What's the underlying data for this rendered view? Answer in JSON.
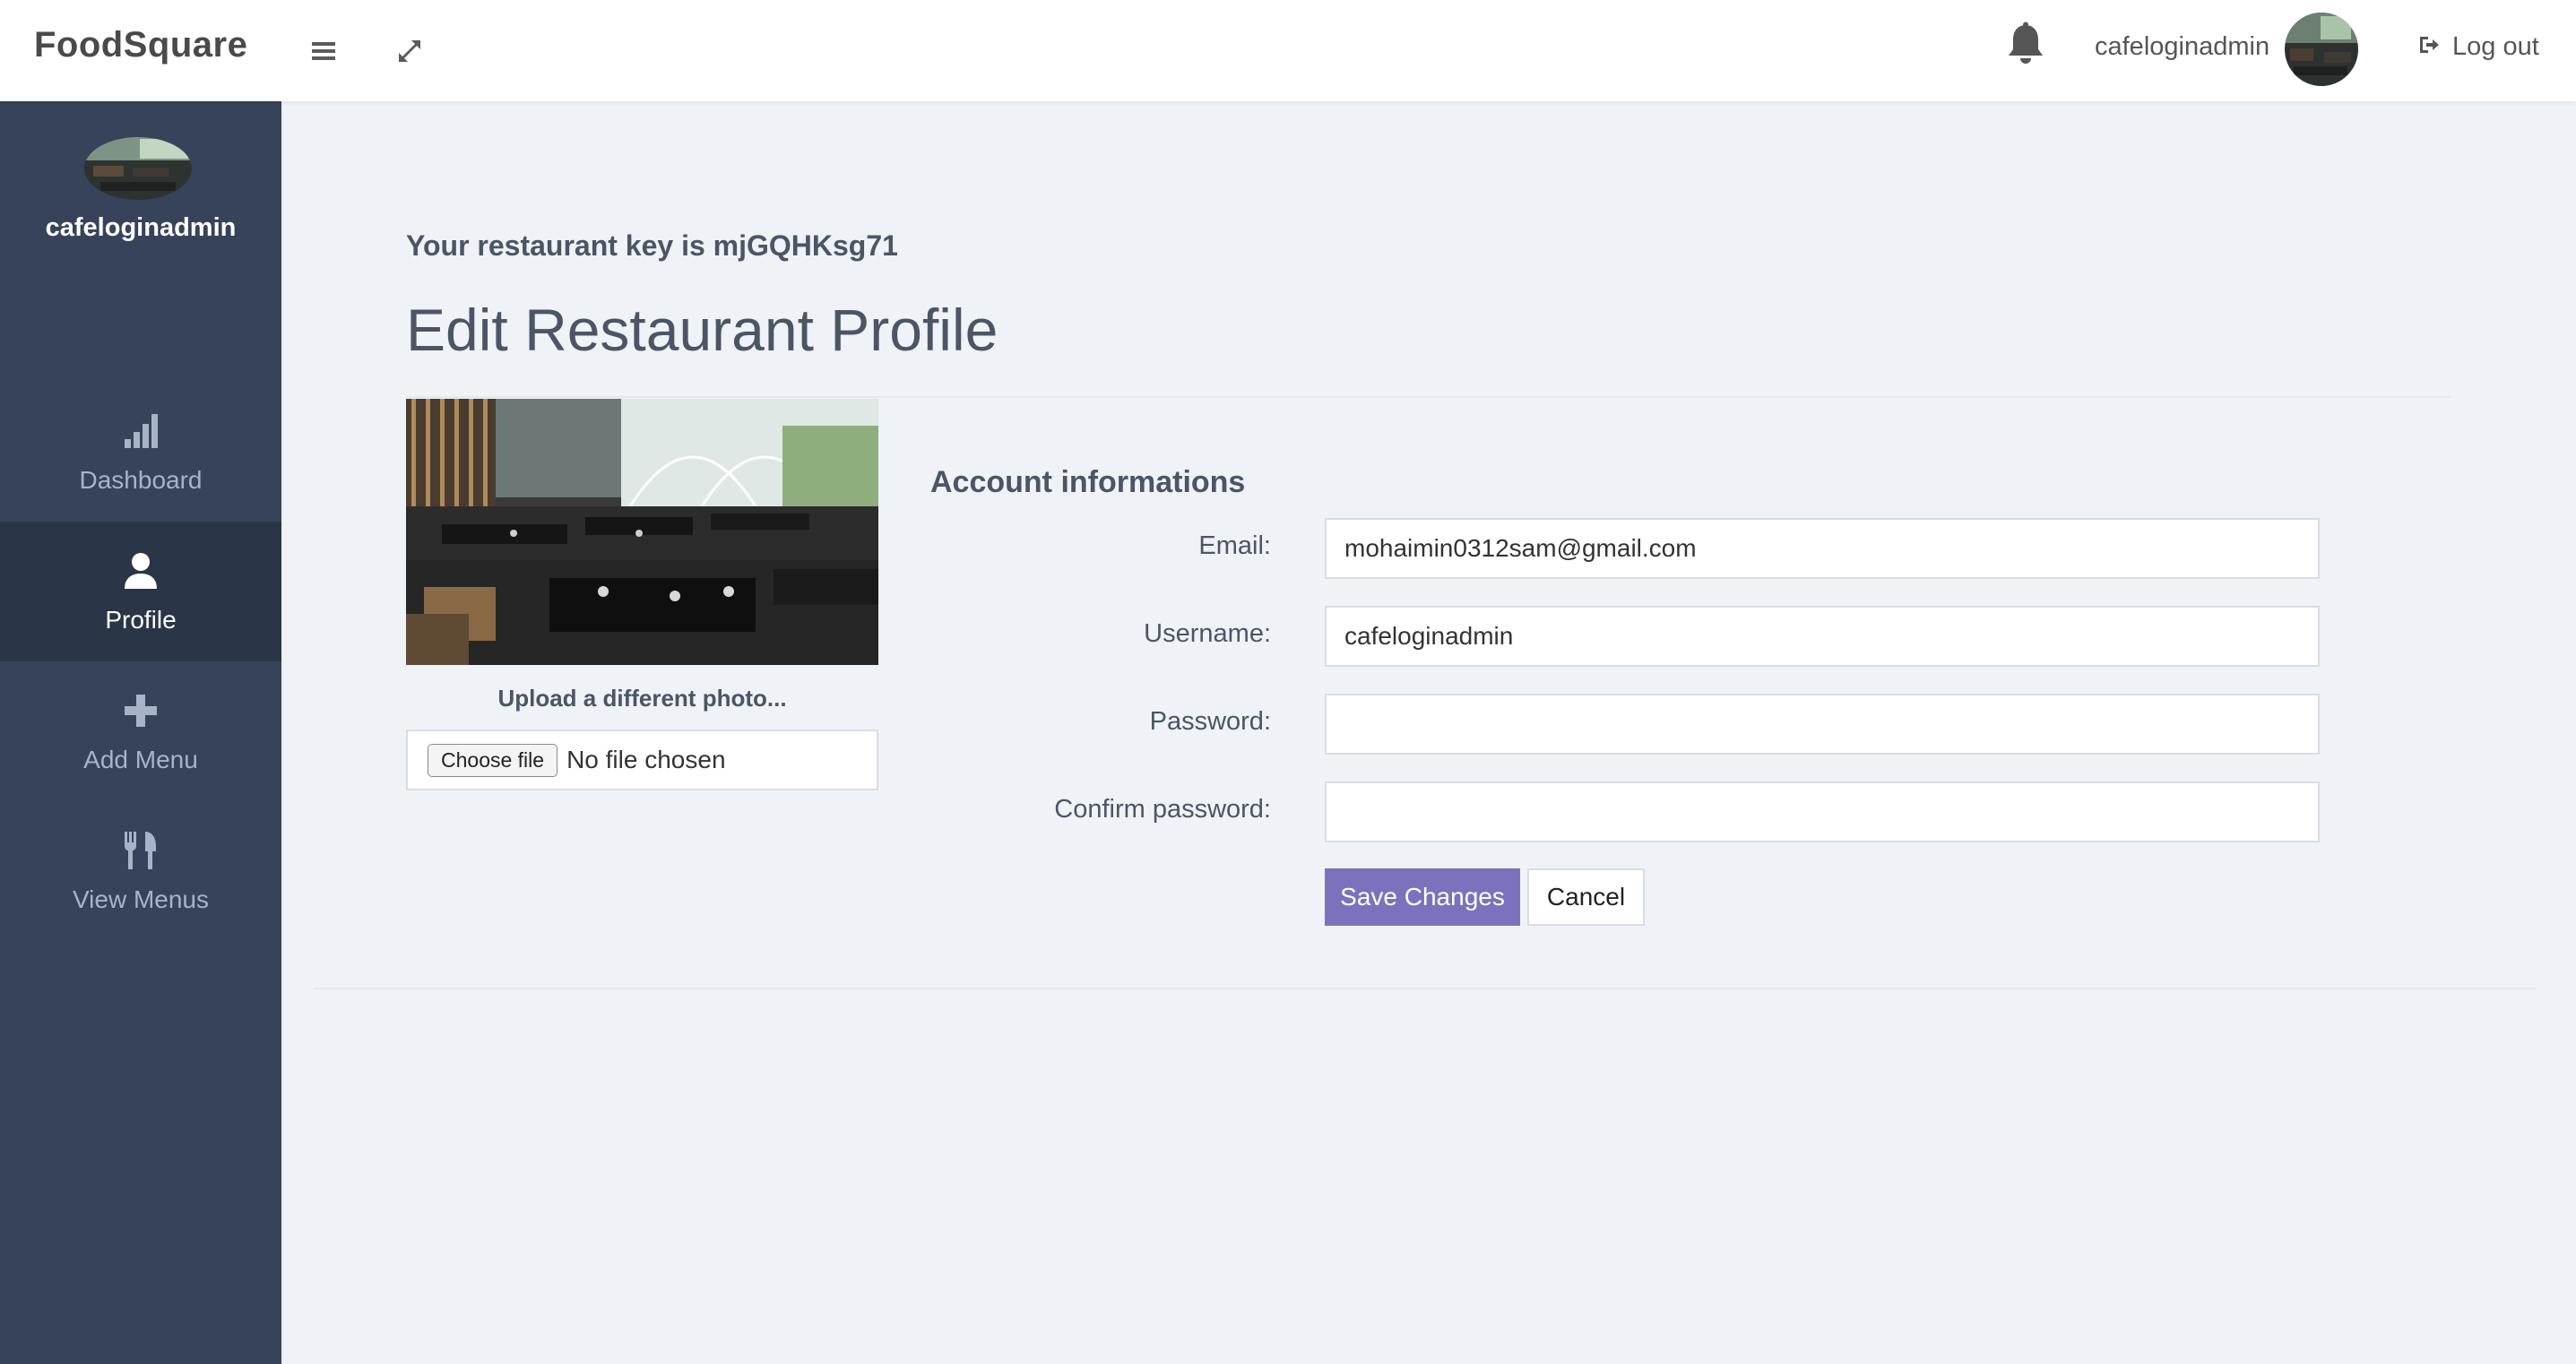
{
  "app": {
    "brand": "FoodSquare"
  },
  "topbar": {
    "icons": [
      "menu-icon",
      "expand-icon",
      "bell-icon",
      "logout-icon"
    ],
    "username": "cafeloginadmin",
    "logout_label": "Log out"
  },
  "sidebar": {
    "username": "cafeloginadmin",
    "items": [
      {
        "label": "Dashboard",
        "icon": "bar-chart-icon",
        "active": false
      },
      {
        "label": "Profile",
        "icon": "user-icon",
        "active": true
      },
      {
        "label": "Add Menu",
        "icon": "plus-icon",
        "active": false
      },
      {
        "label": "View Menus",
        "icon": "cutlery-icon",
        "active": false
      }
    ]
  },
  "main": {
    "restaurant_key_text": "Your restaurant key is mjGQHKsg71",
    "title": "Edit Restaurant Profile",
    "upload_label": "Upload a different photo...",
    "choose_file_label": "Choose file",
    "no_file_text": "No file chosen",
    "account_title": "Account informations",
    "fields": {
      "email": {
        "label": "Email:",
        "value": "mohaimin0312sam@gmail.com"
      },
      "username": {
        "label": "Username:",
        "value": "cafeloginadmin"
      },
      "password": {
        "label": "Password:",
        "value": ""
      },
      "confirm_password": {
        "label": "Confirm password:",
        "value": ""
      }
    },
    "save_label": "Save Changes",
    "cancel_label": "Cancel"
  },
  "colors": {
    "sidebar_bg": "#37435a",
    "sidebar_active_bg": "#2b3548",
    "page_bg": "#eff2f7",
    "primary_button": "#7b72be"
  }
}
